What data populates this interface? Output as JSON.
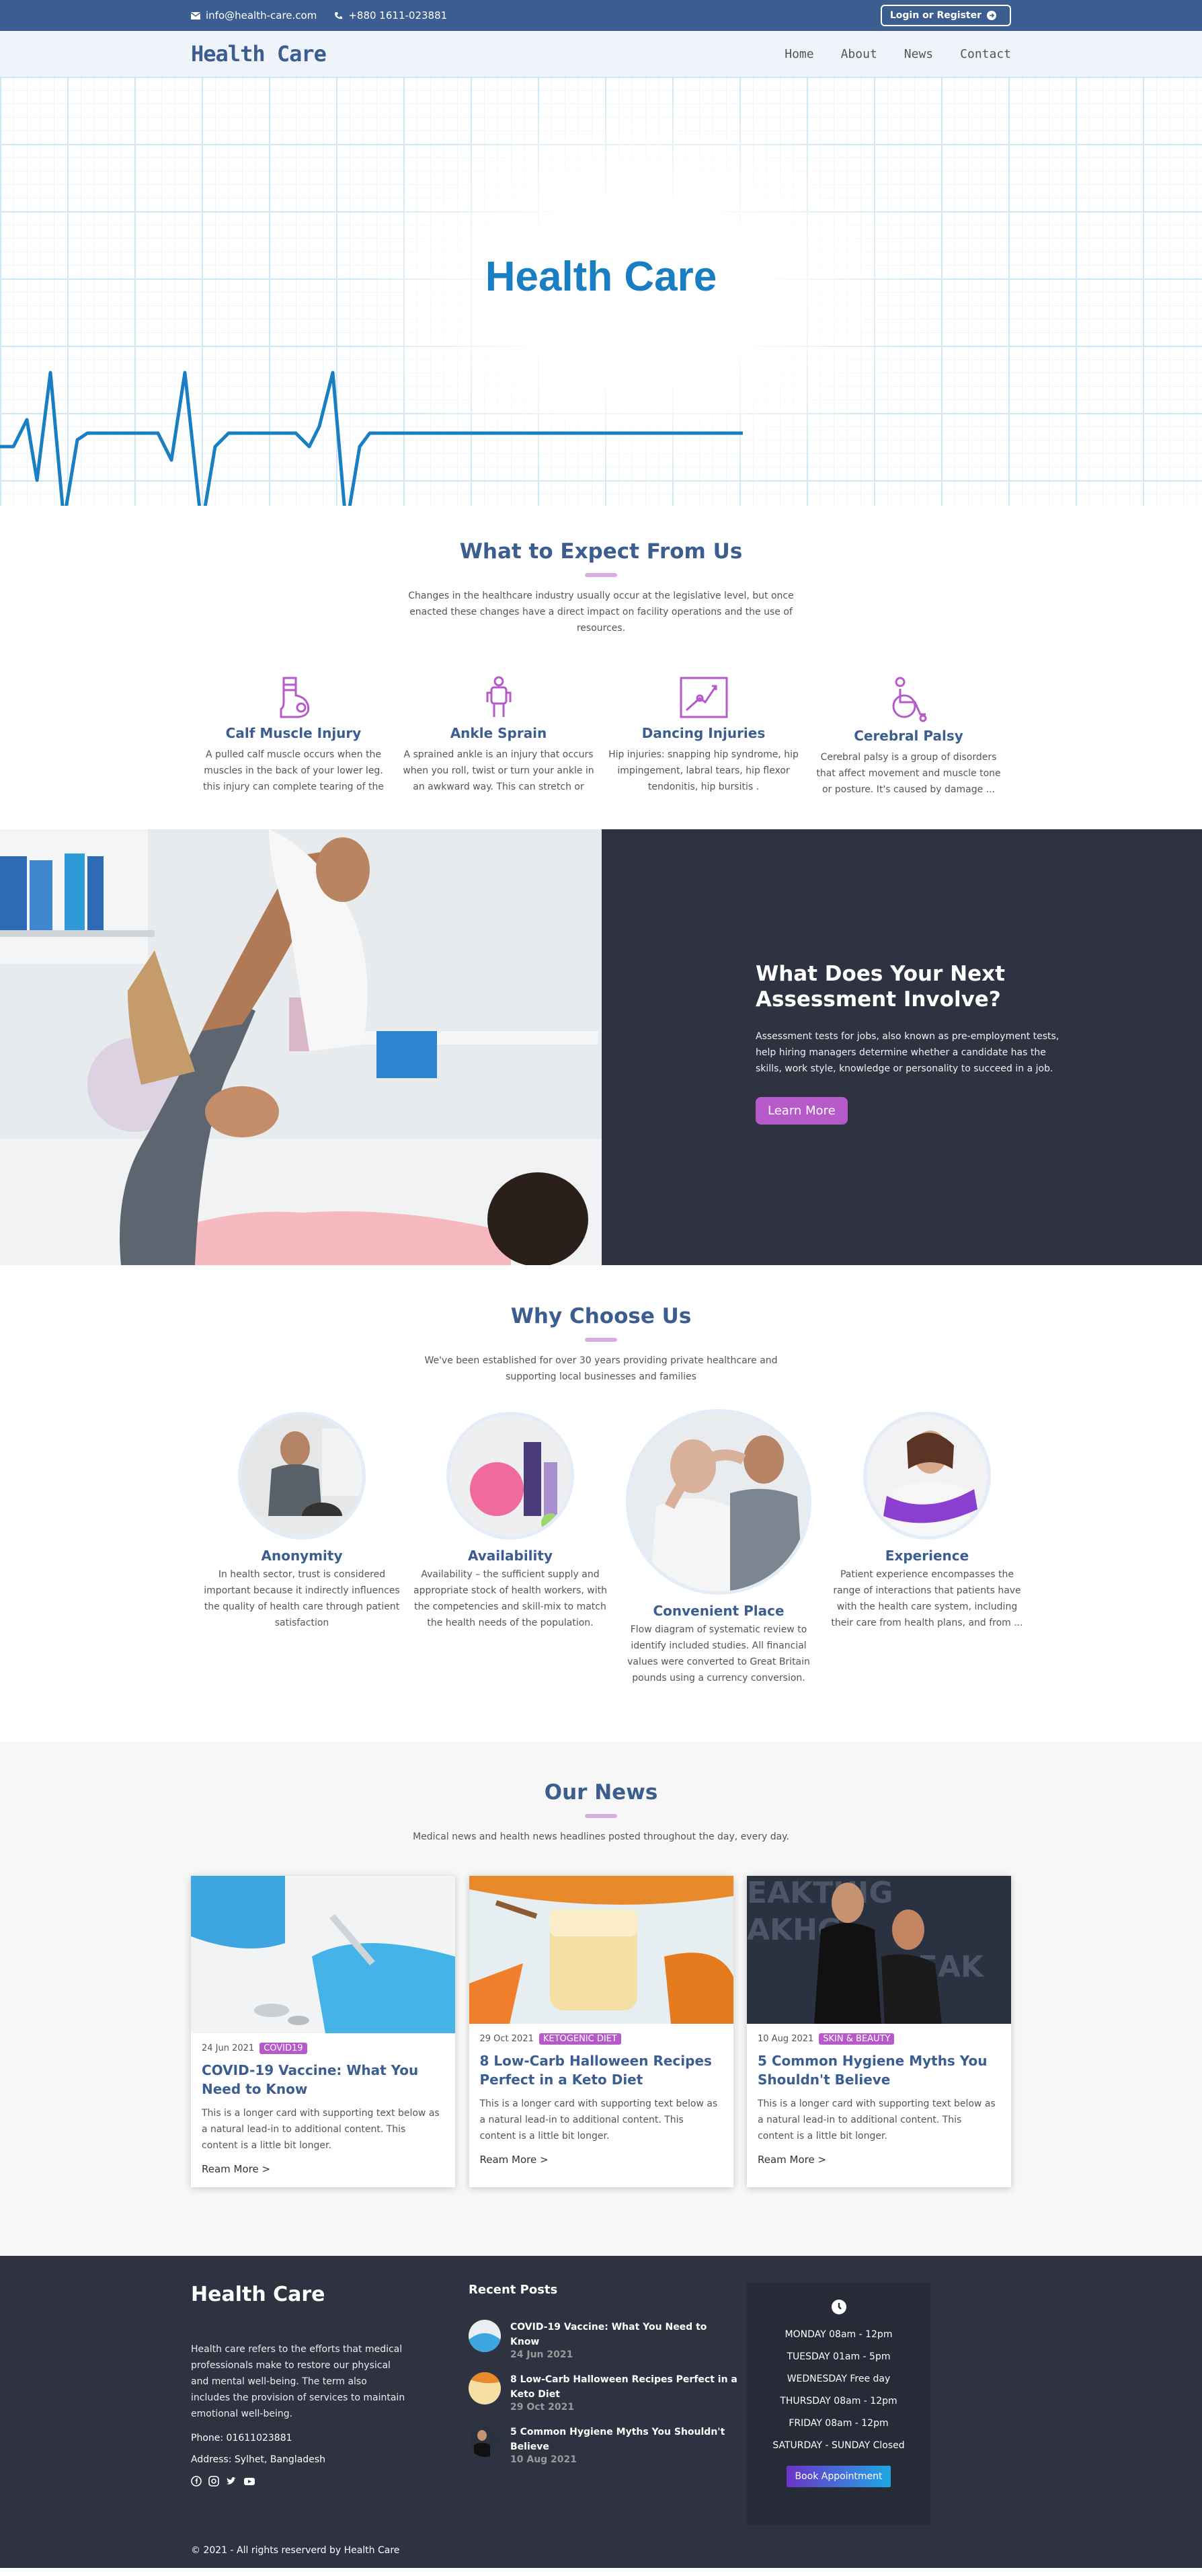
{
  "topbar": {
    "email": "info@health-care.com",
    "phone": "+880 1611-023881",
    "login_label": "Login or Register"
  },
  "nav": {
    "brand": "Health Care",
    "items": [
      "Home",
      "About",
      "News",
      "Contact"
    ]
  },
  "hero": {
    "title": "Health Care"
  },
  "expect": {
    "title": "What to Expect From Us",
    "subtitle": "Changes in the healthcare industry usually occur at the legislative level, but once enacted these changes have a direct impact on facility operations and the use of resources.",
    "features": [
      {
        "icon": "leg-cast-icon",
        "title": "Calf Muscle Injury",
        "text": "A pulled calf muscle occurs when the muscles in the back of your lower leg. this injury can complete tearing of the muscle."
      },
      {
        "icon": "person-icon",
        "title": "Ankle Sprain",
        "text": "A sprained ankle is an injury that occurs when you roll, twist or turn your ankle in an awkward way. This can stretch or tear"
      },
      {
        "icon": "xray-icon",
        "title": "Dancing Injuries",
        "text": "Hip injuries: snapping hip syndrome, hip impingement, labral tears, hip flexor tendonitis, hip bursitis ."
      },
      {
        "icon": "wheelchair-icon",
        "title": "Cerebral Palsy",
        "text": "Cerebral palsy is a group of disorders that affect movement and muscle tone or posture. It's caused by damage ..."
      }
    ]
  },
  "assessment": {
    "title": "What Does Your Next Assessment Involve?",
    "text": "Assessment tests for jobs, also known as pre-employment tests, help hiring managers determine whether a candidate has the skills, work style, knowledge or personality to succeed in a job.",
    "button": "Learn More"
  },
  "why": {
    "title": "Why Choose Us",
    "subtitle": "We've been established for over 30 years providing private healthcare and supporting local businesses and families",
    "items": [
      {
        "title": "Anonymity",
        "text": "In health sector, trust is considered important because it indirectly influences the quality of health care through patient satisfaction"
      },
      {
        "title": "Availability",
        "text": "Availability – the sufficient supply and appropriate stock of health workers, with the competencies and skill-mix to match the health needs of the population."
      },
      {
        "title": "Convenient Place",
        "text": "Flow diagram of systematic review to identify included studies. All financial values were converted to Great Britain pounds using a currency conversion."
      },
      {
        "title": "Experience",
        "text": "Patient experience encompasses the range of interactions that patients have with the health care system, including their care from health plans, and from ..."
      }
    ]
  },
  "news": {
    "title": "Our News",
    "subtitle": "Medical news and health news headlines posted throughout the day, every day.",
    "cards": [
      {
        "date": "24 Jun 2021",
        "tag": "COVID19",
        "title": "COVID-19 Vaccine: What You Need to Know",
        "text": "This is a longer card with supporting text below as a natural lead-in to additional content. This content is a little bit longer.",
        "more": "Ream More >"
      },
      {
        "date": "29 Oct 2021",
        "tag": "KETOGENIC DIET",
        "title": "8 Low-Carb Halloween Recipes Perfect in a Keto Diet",
        "text": "This is a longer card with supporting text below as a natural lead-in to additional content. This content is a little bit longer.",
        "more": "Ream More >"
      },
      {
        "date": "10 Aug 2021",
        "tag": "SKIN & BEAUTY",
        "title": "5 Common Hygiene Myths You Shouldn't Believe",
        "text": "This is a longer card with supporting text below as a natural lead-in to additional content. This content is a little bit longer.",
        "more": "Ream More >"
      }
    ]
  },
  "footer": {
    "brand": "Health Care",
    "description": "Health care refers to the efforts that medical professionals make to restore our physical and mental well-being. The term also includes the provision of services to maintain emotional well-being.",
    "phone": "Phone: 01611023881",
    "address": "Address: Sylhet, Bangladesh",
    "recent_title": "Recent Posts",
    "recent": [
      {
        "title": "COVID-19 Vaccine: What You Need to Know",
        "date": "24 Jun 2021"
      },
      {
        "title": "8 Low-Carb Halloween Recipes Perfect in a Keto Diet",
        "date": "29 Oct 2021"
      },
      {
        "title": "5 Common Hygiene Myths You Shouldn't Believe",
        "date": "10 Aug 2021"
      }
    ],
    "hours": [
      "MONDAY 08am - 12pm",
      "TUESDAY 01am - 5pm",
      "WEDNESDAY Free day",
      "THURSDAY 08am - 12pm",
      "FRIDAY 08am - 12pm",
      "SATURDAY - SUNDAY Closed"
    ],
    "book_label": "Book Appointment",
    "copyright": "© 2021 - All rights reserverd by Health Care"
  },
  "colors": {
    "primary": "#3c5d8f",
    "accent": "#b659c9",
    "dark": "#2e3241",
    "hero_blue": "#1a7fc2"
  }
}
